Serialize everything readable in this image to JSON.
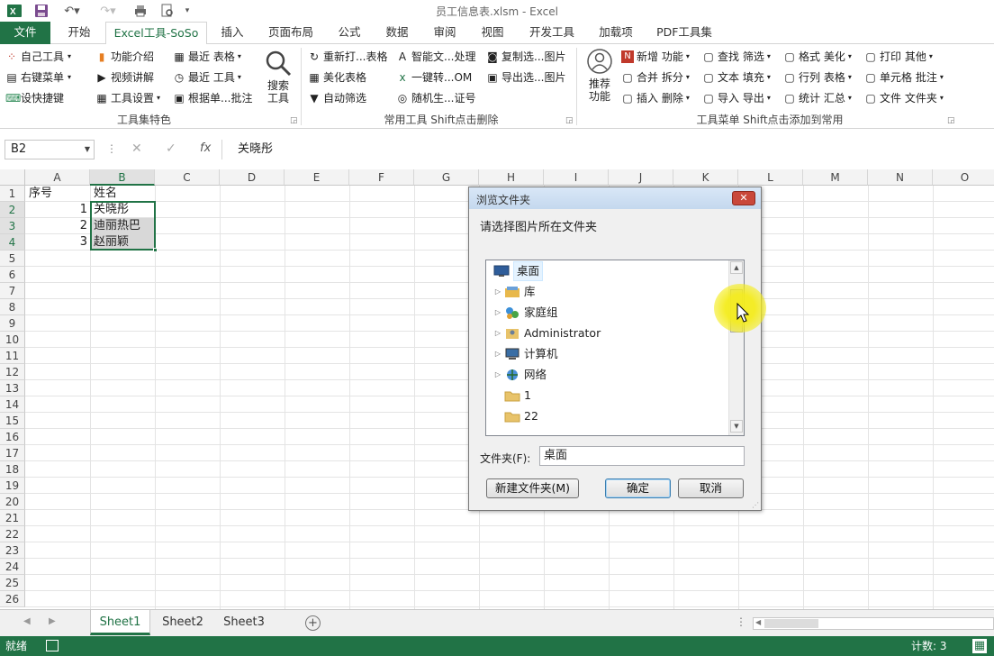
{
  "title_bar": {
    "doc_title": "员工信息表.xlsm - Excel"
  },
  "tabs": [
    "文件",
    "开始",
    "Excel工具-SoSo",
    "插入",
    "页面布局",
    "公式",
    "数据",
    "审阅",
    "视图",
    "开发工具",
    "加载项",
    "PDF工具集"
  ],
  "ribbon": {
    "g1": {
      "label": "工具集特色",
      "items": [
        "自己工具",
        "右键菜单",
        "设快捷键",
        "功能介绍",
        "视频讲解",
        "工具设置",
        "最近 表格",
        "最近 工具",
        "根据单...批注"
      ],
      "search_label": "搜索\n工具"
    },
    "g2": {
      "label": "常用工具 Shift点击删除",
      "items": [
        "重新打...表格",
        "美化表格",
        "自动筛选",
        "智能文...处理",
        "一键转...OM",
        "随机生...证号",
        "复制选...图片",
        "导出选...图片"
      ]
    },
    "g3": {
      "label": "工具菜单 Shift点击添加到常用",
      "recommend": "推荐\n功能",
      "items": [
        "新增 功能",
        "合并 拆分",
        "插入 删除",
        "查找 筛选",
        "文本 填充",
        "导入 导出",
        "格式 美化",
        "行列 表格",
        "统计 汇总",
        "打印 其他",
        "单元格 批注",
        "文件 文件夹"
      ]
    }
  },
  "formula_bar": {
    "name_box": "B2",
    "fx": "fx",
    "content": "关晓彤"
  },
  "columns": [
    "A",
    "B",
    "C",
    "D",
    "E",
    "F",
    "G",
    "H",
    "I",
    "J",
    "K",
    "L",
    "M",
    "N",
    "O"
  ],
  "rows": [
    "1",
    "2",
    "3",
    "4",
    "5",
    "6",
    "7",
    "8",
    "9",
    "10",
    "11",
    "12",
    "13",
    "14",
    "15",
    "16",
    "17",
    "18",
    "19",
    "20",
    "21",
    "22",
    "23",
    "24",
    "25",
    "26"
  ],
  "cells": {
    "A1": "序号",
    "B1": "姓名",
    "A2": "1",
    "B2": "关晓彤",
    "A3": "2",
    "B3": "迪丽热巴",
    "A4": "3",
    "B4": "赵丽颖"
  },
  "sheets": [
    "Sheet1",
    "Sheet2",
    "Sheet3"
  ],
  "status": {
    "ready": "就绪",
    "count": "计数: 3"
  },
  "dialog": {
    "title": "浏览文件夹",
    "prompt": "请选择图片所在文件夹",
    "tree": [
      "桌面",
      "库",
      "家庭组",
      "Administrator",
      "计算机",
      "网络",
      "1",
      "22"
    ],
    "folder_label": "文件夹(F):",
    "folder_value": "桌面",
    "new_folder": "新建文件夹(M)",
    "ok": "确定",
    "cancel": "取消"
  }
}
